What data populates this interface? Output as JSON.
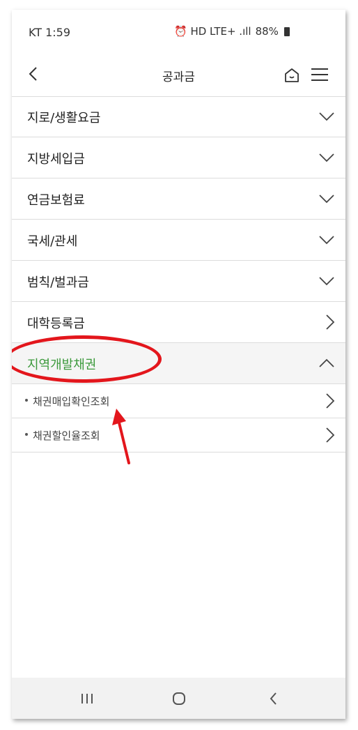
{
  "status_bar": {
    "carrier_time": "KT 1:59",
    "indicators": "⏰ HD LTE+ .ıll",
    "battery": "88%"
  },
  "header": {
    "title": "공과금",
    "back_icon": "chevron-left-icon",
    "home_icon": "home-icon",
    "menu_icon": "hamburger-menu-icon"
  },
  "menu": {
    "items": [
      {
        "label": "지로/생활요금",
        "icon": "chevron-down-icon"
      },
      {
        "label": "지방세입금",
        "icon": "chevron-down-icon"
      },
      {
        "label": "연금보험료",
        "icon": "chevron-down-icon"
      },
      {
        "label": "국세/관세",
        "icon": "chevron-down-icon"
      },
      {
        "label": "범칙/벌과금",
        "icon": "chevron-down-icon"
      },
      {
        "label": "대학등록금",
        "icon": "chevron-right-icon"
      },
      {
        "label": "지역개발채권",
        "icon": "chevron-up-icon"
      }
    ],
    "sub_items": [
      {
        "label": "채권매입확인조회",
        "icon": "chevron-right-icon"
      },
      {
        "label": "채권할인율조회",
        "icon": "chevron-right-icon"
      }
    ]
  },
  "annotation": {
    "color": "#e3161c"
  },
  "accent_color": "#3d9a3d",
  "navigation_bar": {
    "recent_icon": "recent-apps-icon",
    "home_icon": "home-circle-icon",
    "back_icon": "back-chevron-icon"
  }
}
